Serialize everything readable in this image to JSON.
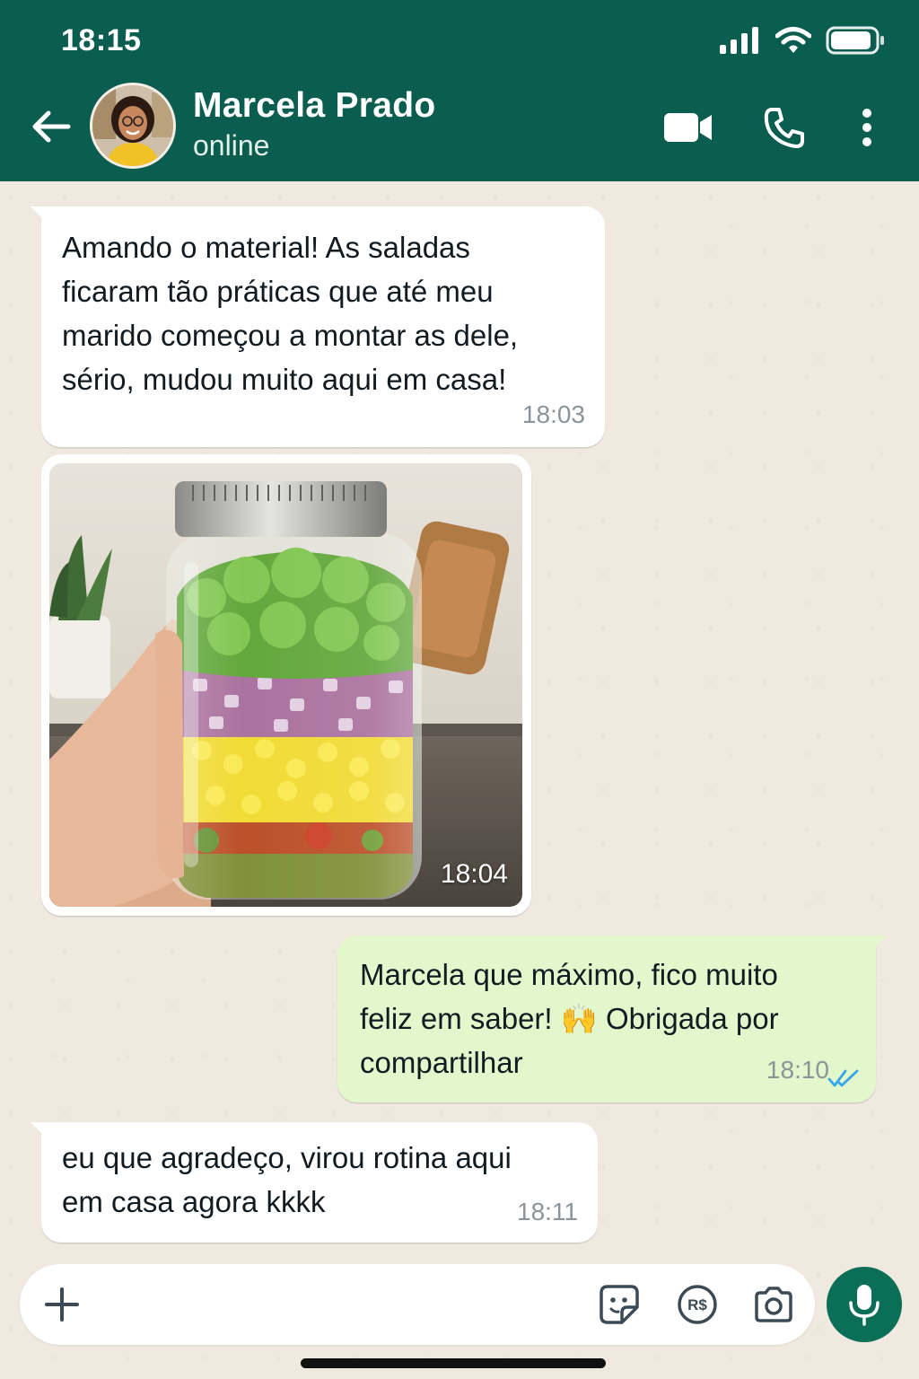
{
  "status_bar": {
    "time": "18:15"
  },
  "header": {
    "contact_name": "Marcela Prado",
    "contact_status": "online",
    "icons": [
      "back-arrow-icon",
      "video-call-icon",
      "phone-icon",
      "more-vertical-icon"
    ]
  },
  "messages": [
    {
      "direction": "incoming",
      "text": "Amando o material! As saladas\nficaram tão práticas que até meu\nmarido começou a montar as dele,\nsério, mudou muito aqui em casa!",
      "time": "18:03"
    },
    {
      "direction": "incoming",
      "type": "image",
      "image_description_icon": "layered-salad-jar-photo",
      "time": "18:04"
    },
    {
      "direction": "outgoing",
      "text": "Marcela que máximo, fico muito\nfeliz em saber! 🙌 Obrigada por\ncompartilhar",
      "time": "18:10",
      "read_status": "read"
    },
    {
      "direction": "incoming",
      "text": "eu que agradeço, virou rotina aqui\nem casa agora kkkk",
      "time": "18:11"
    }
  ],
  "composer": {
    "placeholder": "",
    "icons": [
      "plus-icon",
      "sticker-icon",
      "payment-icon",
      "camera-icon",
      "microphone-icon"
    ]
  },
  "colors": {
    "header_bg": "#0b5e4f",
    "outgoing_bubble": "#e2f7cb",
    "incoming_bubble": "#ffffff",
    "chat_bg": "#efe9df",
    "read_ticks": "#34a5e8",
    "mic_button": "#0b6e57"
  }
}
